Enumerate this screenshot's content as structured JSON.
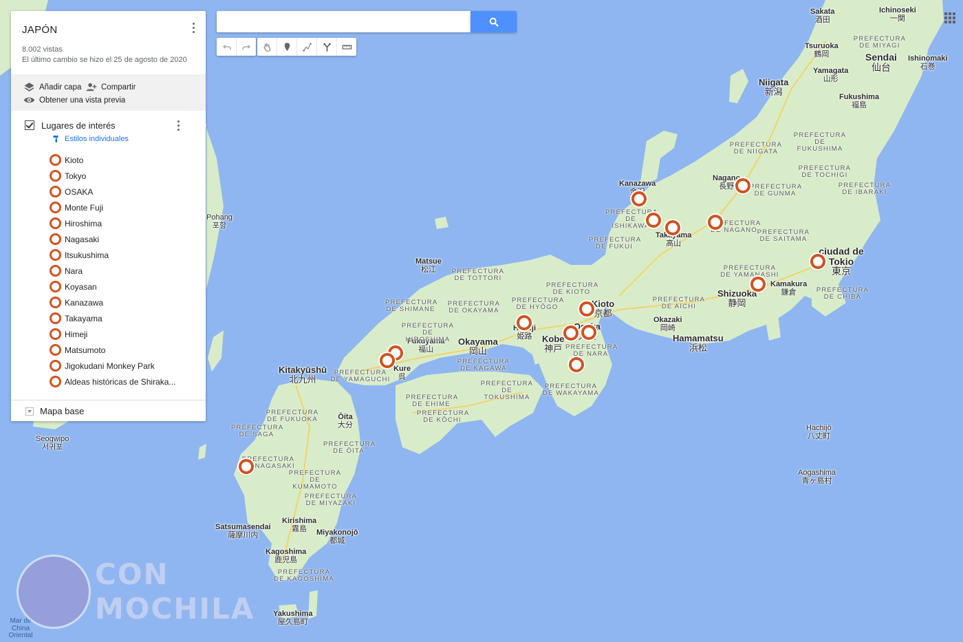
{
  "panel": {
    "title": "JAPÓN",
    "views": "8.002 vistas",
    "last_change": "El último cambio se hizo el 25 de agosto de 2020",
    "actions": {
      "add_layer": "Añadir capa",
      "share": "Compartir",
      "preview": "Obtener una vista previa"
    },
    "layer": {
      "name": "Lugares de interés",
      "checked": true,
      "style": "Estilos individuales",
      "places": [
        "Kioto",
        "Tokyo",
        "OSAKA",
        "Monte Fuji",
        "Hiroshima",
        "Nagasaki",
        "Itsukushima",
        "Nara",
        "Koyasan",
        "Kanazawa",
        "Takayama",
        "Himeji",
        "Matsumoto",
        "Jigokudani Monkey Park",
        "Aldeas históricas de Shiraka..."
      ]
    },
    "base_map": "Mapa base"
  },
  "search": {
    "value": "",
    "placeholder": ""
  },
  "toolbar": {
    "icons": [
      "undo-icon",
      "redo-icon",
      "hand-icon",
      "marker-icon",
      "line-icon",
      "directions-icon",
      "ruler-icon"
    ]
  },
  "colors": {
    "water": "#8fb6f0",
    "land": "#d8ecc9",
    "marker": "#d0531f",
    "search_button": "#4d90fe",
    "link": "#1a73e8"
  },
  "map": {
    "cities": [
      {
        "id": "sakata",
        "name": "Sakata",
        "kanji": "酒田"
      },
      {
        "id": "ichinoseki",
        "name": "Ichinoseki",
        "kanji": "一関"
      },
      {
        "id": "tsuruoka",
        "name": "Tsuruoka",
        "kanji": "鶴岡"
      },
      {
        "id": "sendai",
        "name": "Sendai",
        "kanji": "仙台"
      },
      {
        "id": "ishinomaki",
        "name": "Ishinomaki",
        "kanji": "石巻"
      },
      {
        "id": "yamagata",
        "name": "Yamagata",
        "kanji": "山形"
      },
      {
        "id": "niigata",
        "name": "Niigata",
        "kanji": "新潟"
      },
      {
        "id": "fukushima",
        "name": "Fukushima",
        "kanji": "福島"
      },
      {
        "id": "kanazawa",
        "name": "Kanazawa",
        "kanji": "金沢"
      },
      {
        "id": "nagano",
        "name": "Nagano",
        "kanji": "長野"
      },
      {
        "id": "takayama",
        "name": "Takayama",
        "kanji": "高山"
      },
      {
        "id": "tokio",
        "name": "ciudad de Tokio",
        "kanji": "東京"
      },
      {
        "id": "kamakura",
        "name": "Kamakura",
        "kanji": "鎌倉"
      },
      {
        "id": "shizuoka",
        "name": "Shizuoka",
        "kanji": "静岡"
      },
      {
        "id": "hamamatsu",
        "name": "Hamamatsu",
        "kanji": "浜松"
      },
      {
        "id": "okazaki",
        "name": "Okazaki",
        "kanji": "岡崎"
      },
      {
        "id": "kioto",
        "name": "Kioto",
        "kanji": "京都"
      },
      {
        "id": "osaka",
        "name": "Osaka",
        "kanji": "大阪"
      },
      {
        "id": "kobe",
        "name": "Kobe",
        "kanji": "神戸"
      },
      {
        "id": "himeji",
        "name": "Himeji",
        "kanji": "姫路"
      },
      {
        "id": "okayama",
        "name": "Okayama",
        "kanji": "岡山"
      },
      {
        "id": "fukuyama",
        "name": "Fukuyama",
        "kanji": "福山"
      },
      {
        "id": "matsue",
        "name": "Matsue",
        "kanji": "松江"
      },
      {
        "id": "kure",
        "name": "Kure",
        "kanji": "呉"
      },
      {
        "id": "kitakyushu",
        "name": "Kitakyūshū",
        "kanji": "北九州"
      },
      {
        "id": "oita",
        "name": "Ōita",
        "kanji": "大分"
      },
      {
        "id": "kirishima",
        "name": "Kirishima",
        "kanji": "霧島"
      },
      {
        "id": "miyakonojo",
        "name": "Miyakonojō",
        "kanji": "都城"
      },
      {
        "id": "satsumasendai",
        "name": "Satsumasendai",
        "kanji": "薩摩川内"
      },
      {
        "id": "kagoshima",
        "name": "Kagoshima",
        "kanji": "鹿児島"
      },
      {
        "id": "yakushima",
        "name": "Yakushima",
        "kanji": "屋久島町"
      },
      {
        "id": "hachijo",
        "name": "Hachijō",
        "kanji": "八丈町"
      },
      {
        "id": "aogashima",
        "name": "Aogashima",
        "kanji": "青ヶ島村"
      },
      {
        "id": "pohang",
        "name": "Pohang",
        "kanji": "포항"
      },
      {
        "id": "seogwipo",
        "name": "Seogwipo",
        "kanji": "서귀포"
      }
    ],
    "prefectures": [
      {
        "id": "miyagi",
        "name": "PREFECTURA DE MIYAGI"
      },
      {
        "id": "fukushima",
        "name": "PREFECTURA DE FUKUSHIMA"
      },
      {
        "id": "niigata",
        "name": "PREFECTURA DE NIIGATA"
      },
      {
        "id": "tochigi",
        "name": "PREFECTURA DE TOCHIGI"
      },
      {
        "id": "gunma",
        "name": "PREFECTURA DE GUNMA"
      },
      {
        "id": "ibaraki",
        "name": "PREFECTURA DE IBARAKI"
      },
      {
        "id": "ishikawa",
        "name": "PREFECTURA DE ISHIKAWA"
      },
      {
        "id": "nagano",
        "name": "PREFECTURA DE NAGANO"
      },
      {
        "id": "fukui",
        "name": "PREFECTURA DE FUKUI"
      },
      {
        "id": "saitama",
        "name": "PREFECTURA DE SAITAMA"
      },
      {
        "id": "yamanashi",
        "name": "PREFECTURA DE YAMANASHI"
      },
      {
        "id": "chiba",
        "name": "PREFECTURA DE CHIBA"
      },
      {
        "id": "aichi",
        "name": "PREFECTURA DE AICHI"
      },
      {
        "id": "kioto",
        "name": "PREFECTURA DE KIOTO"
      },
      {
        "id": "hyogo",
        "name": "PREFECTURA DE HYŌGO"
      },
      {
        "id": "tottori",
        "name": "PREFECTURA DE TOTTORI"
      },
      {
        "id": "shimane",
        "name": "PREFECTURA DE SHIMANE"
      },
      {
        "id": "okayama",
        "name": "PREFECTURA DE OKAYAMA"
      },
      {
        "id": "hiroshima",
        "name": "PREFECTURA DE HIROSHIMA"
      },
      {
        "id": "yamaguchi",
        "name": "PREFECTURA DE YAMAGUCHI"
      },
      {
        "id": "kagawa",
        "name": "PREFECTURA DE KAGAWA"
      },
      {
        "id": "tokushima",
        "name": "PREFECTURA DE TOKUSHIMA"
      },
      {
        "id": "ehime",
        "name": "PREFECTURA DE EHIME"
      },
      {
        "id": "kochi",
        "name": "PREFECTURA DE KŌCHI"
      },
      {
        "id": "nara",
        "name": "PREFECTURA DE NARA"
      },
      {
        "id": "wakayama",
        "name": "PREFECTURA DE WAKAYAMA"
      },
      {
        "id": "fukuoka",
        "name": "PREFECTURA DE FUKUOKA"
      },
      {
        "id": "saga",
        "name": "PREFECTURA DE SAGA"
      },
      {
        "id": "nagasaki",
        "name": "PREFECTURA DE NAGASAKI"
      },
      {
        "id": "oita",
        "name": "PREFECTURA DE ŌITA"
      },
      {
        "id": "kumamoto",
        "name": "PREFECTURA DE KUMAMOTO"
      },
      {
        "id": "miyazaki",
        "name": "PREFECTURA DE MIYAZAKI"
      },
      {
        "id": "kagoshima",
        "name": "PREFECTURA DE KAGOSHIMA"
      }
    ],
    "seas": [
      {
        "id": "china",
        "name": "Mar de China Oriental"
      }
    ]
  },
  "watermark": {
    "line1": "CON",
    "line2": "MOCHILA"
  }
}
